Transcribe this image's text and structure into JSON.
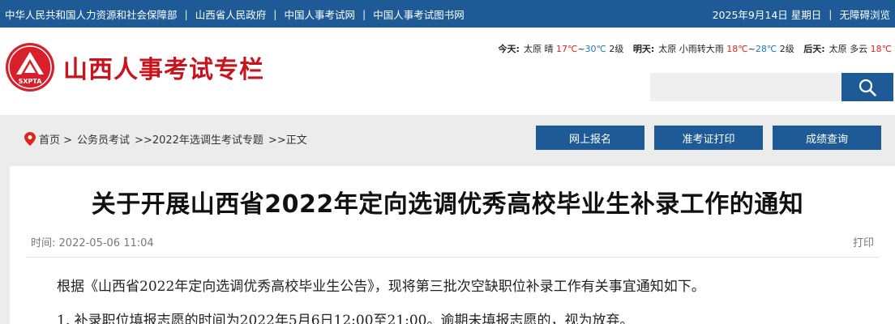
{
  "topbar": {
    "links": [
      "中华人民共和国人力资源和社会保障部",
      "山西省人民政府",
      "中国人事考试网",
      "中国人事考试图书网"
    ],
    "date": "2025年9月14日 星期日",
    "accessibility": "无障碍浏览"
  },
  "header": {
    "logo_abbr": "SXPTA",
    "site_name": "山西人事考试专栏"
  },
  "weather": {
    "today_label": "今天:",
    "today_city": "太原",
    "today_cond": "晴",
    "today_high": "17℃",
    "today_low": "30℃",
    "today_wind": "2级",
    "tomorrow_label": "明天:",
    "tomorrow_city": "太原",
    "tomorrow_cond": "小雨转大雨",
    "tomorrow_high": "18℃",
    "tomorrow_low": "28℃",
    "tomorrow_wind": "2级",
    "after_label": "后天:",
    "after_city": "太原",
    "after_cond": "多云",
    "after_high": "18℃"
  },
  "search": {
    "placeholder": ""
  },
  "breadcrumb": [
    "首页 >",
    "公务员考试",
    ">>2022年选调生考试专题",
    ">>正文"
  ],
  "nav_buttons": [
    "网上报名",
    "准考证打印",
    "成绩查询"
  ],
  "article": {
    "title": "关于开展山西省2022年定向选调优秀高校毕业生补录工作的通知",
    "time_label": "时间:",
    "time_value": "2022-05-06 11:04",
    "print_label": "打印",
    "para1": "根据《山西省2022年定向选调优秀高校毕业生公告》，现将第三批次空缺职位补录工作有关事宜通知如下。",
    "para2": "1. 补录职位填报志愿的时间为2022年5月6日12:00至21:00。逾期未填报志愿的，视为放弃。"
  },
  "colors": {
    "primary": "#1e5a96",
    "brand_red": "#c8141d"
  }
}
